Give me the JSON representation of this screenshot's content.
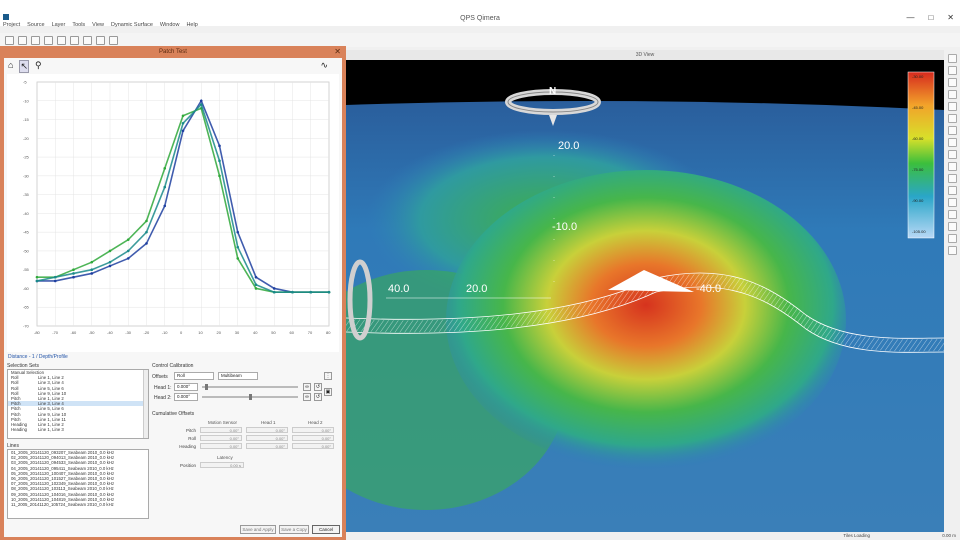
{
  "app": {
    "title": "QPS Qimera",
    "menu": [
      "Project",
      "Source",
      "Layer",
      "Tools",
      "View",
      "Dynamic Surface",
      "Window",
      "Help"
    ]
  },
  "dialog": {
    "title": "Patch Test",
    "plot_link": "Distance - 1 / Depth/Profile",
    "selection_sets_label": "Selection Sets",
    "selection_rows": [
      {
        "a": "Manual Selection",
        "b": ""
      },
      {
        "a": "Roll",
        "b": "Line 1, Line 2"
      },
      {
        "a": "Roll",
        "b": "Line 3, Line 4"
      },
      {
        "a": "Roll",
        "b": "Line 5, Line 6"
      },
      {
        "a": "Roll",
        "b": "Line 9, Line 10"
      },
      {
        "a": "Pitch",
        "b": "Line 1, Line 2"
      },
      {
        "a": "Pitch",
        "b": "Line 3, Line 4"
      },
      {
        "a": "Pitch",
        "b": "Line 5, Line 6"
      },
      {
        "a": "Pitch",
        "b": "Line 9, Line 10"
      },
      {
        "a": "Pitch",
        "b": "Line 1, Line 11"
      },
      {
        "a": "Heading",
        "b": "Line 1, Line 2"
      },
      {
        "a": "Heading",
        "b": "Line 1, Line 3"
      }
    ],
    "lines_label": "Lines",
    "lines": [
      "01_2005_20141120_093207_Seabeam 2010_0.0 kHz",
      "02_2005_20141120_094013_Seabeam 2010_0.0 kHz",
      "03_2005_20141120_094533_Seabeam 2010_0.0 kHz",
      "04_2005_20141120_095411_Seabeam 2010_0.0 kHz",
      "05_2005_20141120_100407_Seabeam 2010_0.0 kHz",
      "06_2005_20141120_101527_Seabeam 2010_0.0 kHz",
      "07_2005_20141120_102349_Seabeam 2010_0.0 kHz",
      "08_2005_20141120_103113_Seabeam 2010_0.0 kHz",
      "09_2005_20141120_104016_Seabeam 2010_0.0 kHz",
      "10_2005_20141120_104819_Seabeam 2010_0.0 kHz",
      "11_2005_20141120_105724_Seabeam 2010_0.0 kHz"
    ],
    "control_calibration_label": "Control Calibration",
    "offsets_label": "Offsets",
    "offset_select": "Roll",
    "offset_select2": "Multibeam",
    "head1_label": "Head 1:",
    "head1_value": "0.000°",
    "head2_label": "Head 2:",
    "head2_value": "0.000°",
    "cumulative_label": "Cumulative Offsets",
    "columns": [
      "Motion Sensor",
      "Head 1",
      "Head 2"
    ],
    "rows": [
      {
        "label": "Pitch",
        "values": [
          "0.00°",
          "0.00°",
          "0.00°"
        ]
      },
      {
        "label": "Roll",
        "values": [
          "0.00°",
          "0.00°",
          "0.00°"
        ]
      },
      {
        "label": "Heading",
        "values": [
          "0.00°",
          "0.00°",
          "0.00°"
        ]
      }
    ],
    "latency_label": "Latency",
    "position_label": "Position",
    "latency_value": "0.00 s",
    "buttons": {
      "save_apply": "Save and Apply",
      "save_copy": "Save a Copy",
      "cancel": "Cancel"
    }
  },
  "view": {
    "title": "3D View",
    "compass_letter": "N",
    "depth_labels": [
      "20.0",
      "-10.0",
      "40.0",
      "20.0",
      "-40.0"
    ],
    "colorbar_ticks": [
      "-30.00",
      "-45.00",
      "-60.00",
      "-75.00",
      "-90.00",
      "-105.00"
    ],
    "status_text": "Tiles Loading",
    "status_zoom": "0.00 m"
  },
  "chart_data": {
    "type": "scatter",
    "title": "",
    "xlabel": "",
    "ylabel": "",
    "x": [
      -80,
      -70,
      -60,
      -50,
      -40,
      -30,
      -20,
      -10,
      0,
      10,
      20,
      30,
      40,
      50,
      60,
      70,
      80
    ],
    "series": [
      {
        "values": [
          -58,
          -58,
          -57,
          -56,
          -54,
          -52,
          -48,
          -38,
          -18,
          -10,
          -22,
          -45,
          -57,
          -60,
          -61,
          -61,
          -61
        ],
        "color": "#1e3fa0"
      },
      {
        "values": [
          -57,
          -57,
          -55,
          -53,
          -50,
          -47,
          -42,
          -28,
          -14,
          -12,
          -30,
          -52,
          -60,
          -61,
          -61,
          -61,
          -61
        ],
        "color": "#2fa83a"
      },
      {
        "values": [
          -58,
          -57,
          -56,
          -55,
          -53,
          -50,
          -45,
          -33,
          -16,
          -11,
          -26,
          -49,
          -59,
          -61,
          -61,
          -61,
          -61
        ],
        "color": "#1a8a8a"
      }
    ],
    "xlim": [
      -80,
      80
    ],
    "ylim": [
      -70,
      -5
    ],
    "grid": true
  }
}
